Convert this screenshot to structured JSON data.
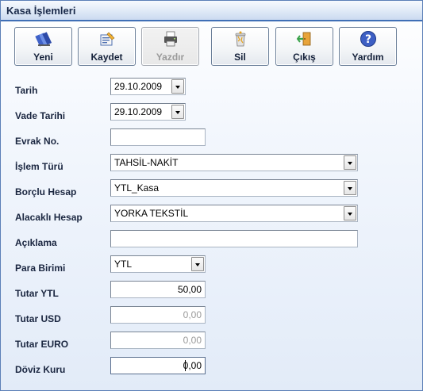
{
  "window": {
    "title": "Kasa İşlemleri"
  },
  "toolbar": [
    {
      "label": "Yeni",
      "icon": "books-icon",
      "enabled": true
    },
    {
      "label": "Kaydet",
      "icon": "save-note-icon",
      "enabled": true
    },
    {
      "label": "Yazdır",
      "icon": "printer-icon",
      "enabled": false
    },
    {
      "label": "Sil",
      "icon": "trash-icon",
      "enabled": true
    },
    {
      "label": "Çıkış",
      "icon": "exit-door-icon",
      "enabled": true
    },
    {
      "label": "Yardım",
      "icon": "help-icon",
      "enabled": true
    }
  ],
  "form": {
    "tarih": {
      "label": "Tarih",
      "value": "29.10.2009"
    },
    "vade_tarihi": {
      "label": "Vade Tarihi",
      "value": "29.10.2009"
    },
    "evrak_no": {
      "label": "Evrak No.",
      "value": ""
    },
    "islem_turu": {
      "label": "İşlem Türü",
      "value": "TAHSİL-NAKİT"
    },
    "borclu_hesap": {
      "label": "Borçlu Hesap",
      "value": "YTL_Kasa"
    },
    "alacakli_hesap": {
      "label": "Alacaklı Hesap",
      "value": "YORKA TEKSTİL"
    },
    "aciklama": {
      "label": "Açıklama",
      "value": ""
    },
    "para_birimi": {
      "label": "Para Birimi",
      "value": "YTL"
    },
    "tutar_ytl": {
      "label": "Tutar YTL",
      "value": "50,00"
    },
    "tutar_usd": {
      "label": "Tutar USD",
      "value": "0,00"
    },
    "tutar_euro": {
      "label": "Tutar EURO",
      "value": "0,00"
    },
    "doviz_kuru": {
      "label": "Döviz Kuru",
      "value": "0,00"
    }
  }
}
